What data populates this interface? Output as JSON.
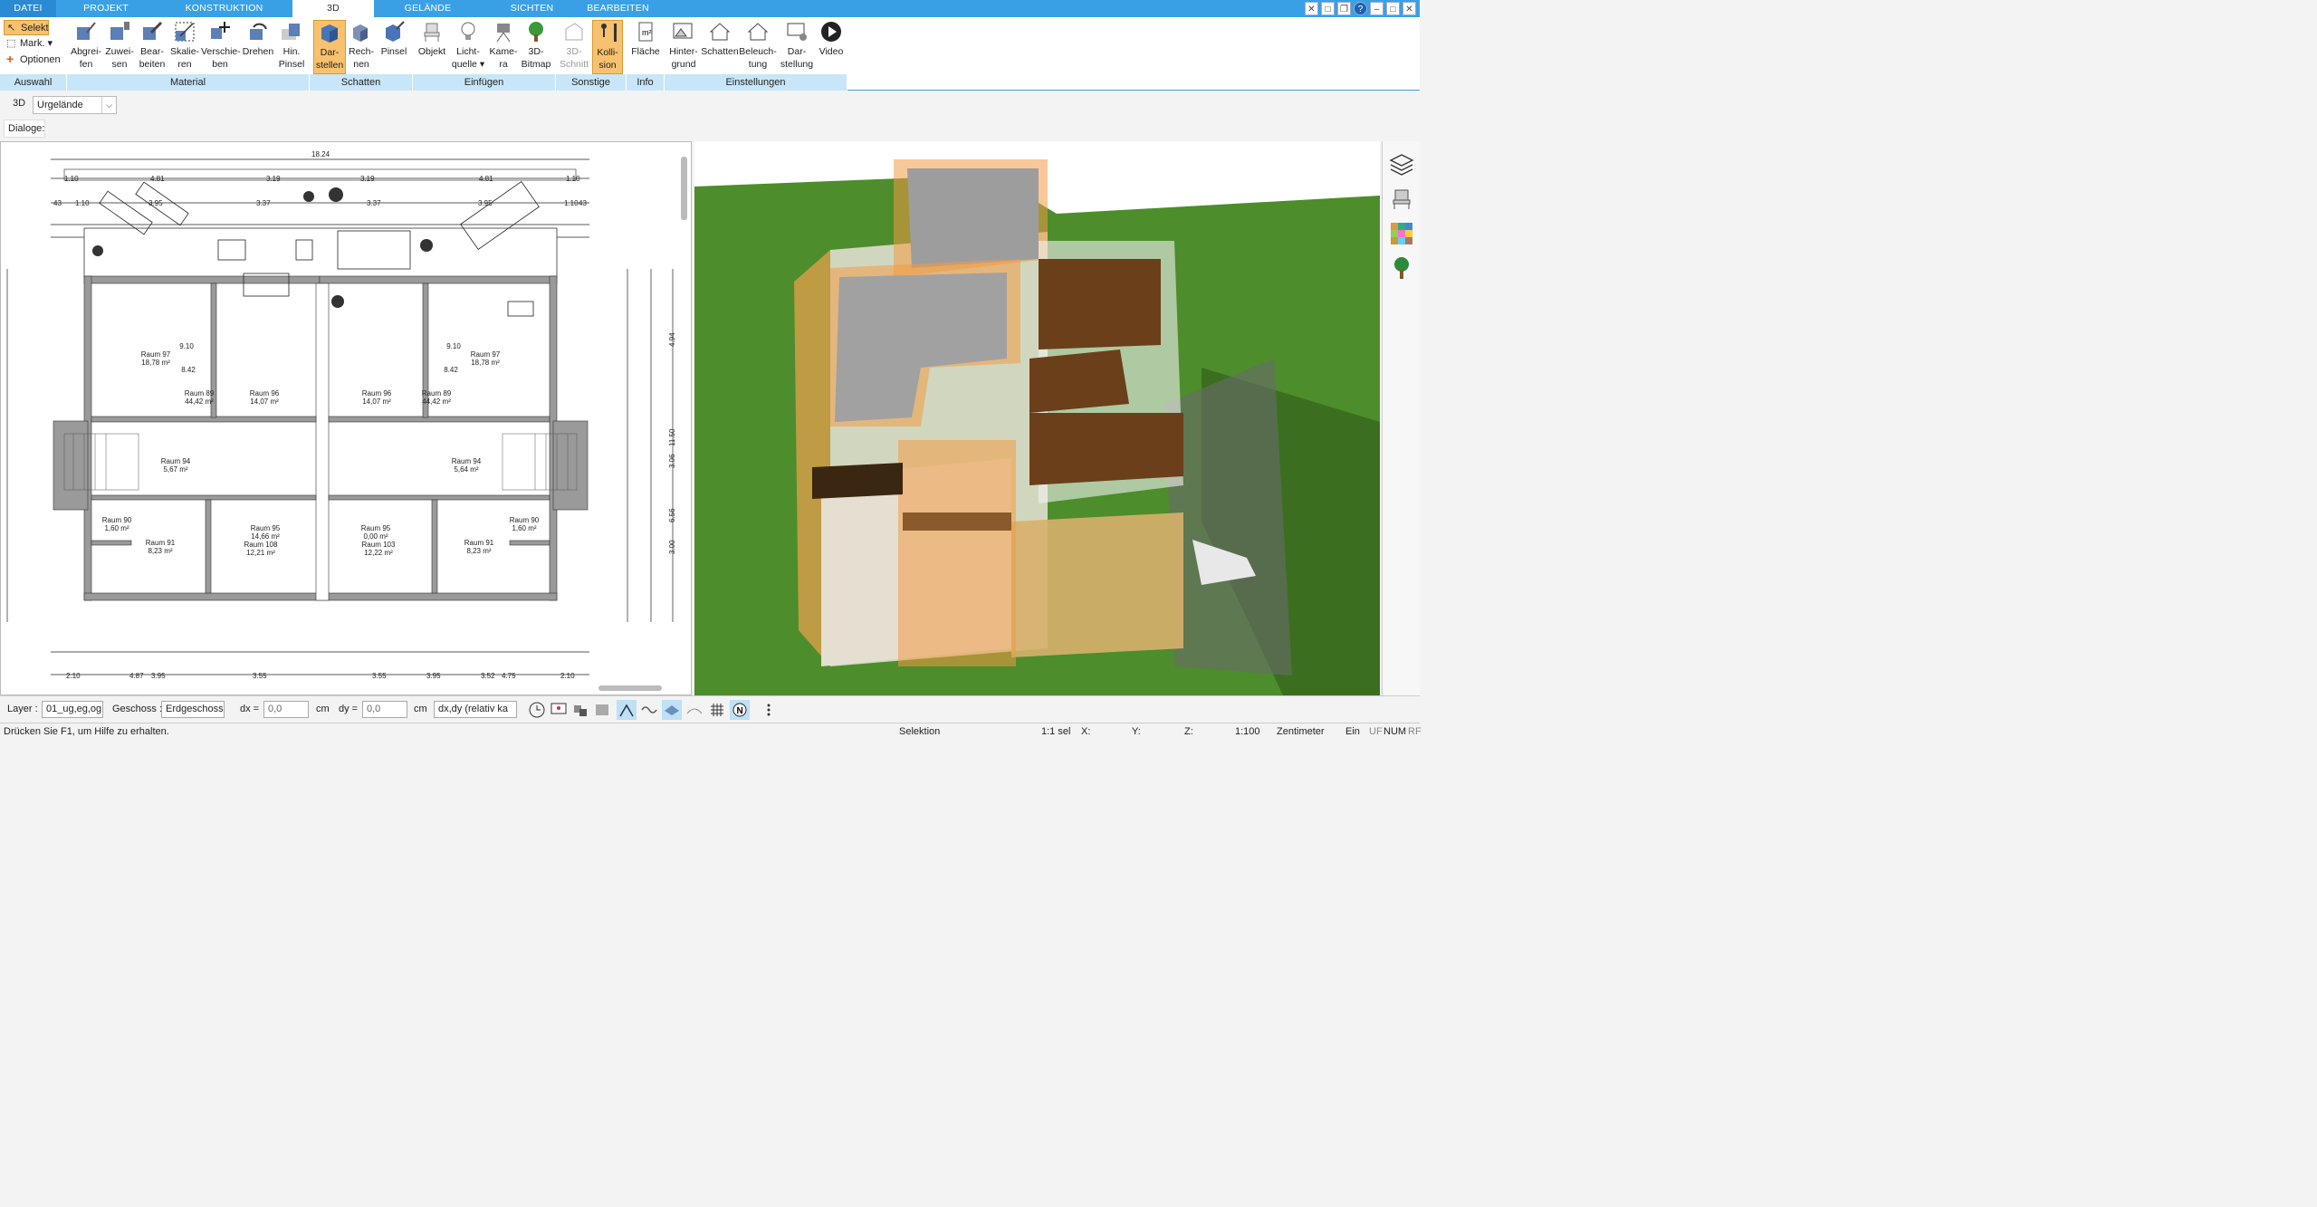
{
  "tabs": [
    "DATEI",
    "PROJEKT",
    "KONSTRUKTION",
    "3D",
    "GELÄNDE",
    "SICHTEN",
    "BEARBEITEN"
  ],
  "ribbon": {
    "auswahl": {
      "select": "Selekt",
      "mark": "Mark.",
      "options": "Optionen",
      "group": "Auswahl"
    },
    "material": {
      "buttons": [
        [
          "Abgrei-",
          "fen"
        ],
        [
          "Zuwei-",
          "sen"
        ],
        [
          "Bear-",
          "beiten"
        ],
        [
          "Skalie-",
          "ren"
        ],
        [
          "Verschie-",
          "ben"
        ],
        [
          "Drehen",
          ""
        ],
        [
          "Hin.",
          "Pinsel"
        ]
      ],
      "group": "Material"
    },
    "schatten": {
      "buttons": [
        [
          "Dar-",
          "stellen"
        ],
        [
          "Rech-",
          "nen"
        ],
        [
          "Pinsel",
          ""
        ]
      ],
      "group": "Schatten"
    },
    "einfuegen": {
      "buttons": [
        [
          "Objekt",
          ""
        ],
        [
          "Licht-",
          "quelle"
        ],
        [
          "Kame-",
          "ra"
        ],
        [
          "3D-",
          "Bitmap"
        ]
      ],
      "group": "Einfügen"
    },
    "sonstige": {
      "buttons": [
        [
          "3D-",
          "Schnitt"
        ],
        [
          "Kolli-",
          "sion"
        ]
      ],
      "group": "Sonstige"
    },
    "info": {
      "buttons": [
        [
          "Fläche",
          ""
        ]
      ],
      "group": "Info"
    },
    "einstellungen": {
      "buttons": [
        [
          "Hinter-",
          "grund"
        ],
        [
          "Schatten",
          ""
        ],
        [
          "Beleuch-",
          "tung"
        ],
        [
          "Dar-",
          "stellung"
        ],
        [
          "Video",
          ""
        ]
      ],
      "group": "Einstellungen"
    }
  },
  "toolbar2": {
    "mode": "3D",
    "dropdown": "Urgelände"
  },
  "dialoge_label": "Dialoge:",
  "plan": {
    "top_dim": "18.24",
    "dims_row1": [
      "1.10",
      "4.81",
      "3.19",
      "3.19",
      "4.81",
      "1.10"
    ],
    "dims_row2": [
      "43",
      "1.10",
      "3.95",
      "3.37",
      "3.37",
      "3.95",
      "1.10",
      "43"
    ],
    "rooms": [
      {
        "name": "Raum 97",
        "area": "18,78 m²"
      },
      {
        "name": "Raum 89",
        "area": "44,42 m²"
      },
      {
        "name": "Raum 96",
        "area": "14,07 m²"
      },
      {
        "name": "Raum 96",
        "area": "14,07 m²"
      },
      {
        "name": "Raum 89",
        "area": "44,42 m²"
      },
      {
        "name": "Raum 97",
        "area": "18,78 m²"
      },
      {
        "name": "Raum 94",
        "area": "5,67 m²"
      },
      {
        "name": "Raum 94",
        "area": "5,64 m²"
      },
      {
        "name": "Raum 95",
        "area": "14,66 m²"
      },
      {
        "name": "Raum 108",
        "area": "12,21 m²"
      },
      {
        "name": "Raum 95",
        "area": "0,00 m²"
      },
      {
        "name": "Raum 103",
        "area": "12,22 m²"
      },
      {
        "name": "Raum 90",
        "area": "1,60 m²"
      },
      {
        "name": "Raum 91",
        "area": "8,23 m²"
      },
      {
        "name": "Raum 90",
        "area": "1,60 m²"
      },
      {
        "name": "Raum 91",
        "area": "8,23 m²"
      }
    ],
    "dim_910": "9.10",
    "dim_842": "8.42",
    "right_dims": [
      "4.94",
      "11.50",
      "3.06",
      "6.56",
      "3.00"
    ],
    "bottom_dims": [
      "2.10",
      "4.87",
      "3.95",
      "3.55",
      "3.55",
      "3.95",
      "3.52",
      "4.75",
      "2.10"
    ]
  },
  "bottombar": {
    "layer_label": "Layer :",
    "layer_value": "01_ug,eg,og",
    "geschoss_label": "Geschoss :",
    "geschoss_value": "Erdgeschoss",
    "dx_label": "dx =",
    "dx_value": "0,0",
    "dx_unit": "cm",
    "dy_label": "dy =",
    "dy_value": "0,0",
    "dy_unit": "cm",
    "mode_value": "dx,dy (relativ ka"
  },
  "status": {
    "help": "Drücken Sie F1, um Hilfe zu erhalten.",
    "selection": "Selektion",
    "sel_count": "1:1 sel",
    "x": "X:",
    "y": "Y:",
    "z": "Z:",
    "scale": "1:100",
    "unit": "Zentimeter",
    "ein": "Ein",
    "uf": "UF",
    "num": "NUM",
    "rf": "RF"
  },
  "colors": {
    "accent": "#3aa0e6",
    "active": "#f7c16f",
    "grass": "#4f8f2c",
    "orange": "#f2a35a"
  }
}
